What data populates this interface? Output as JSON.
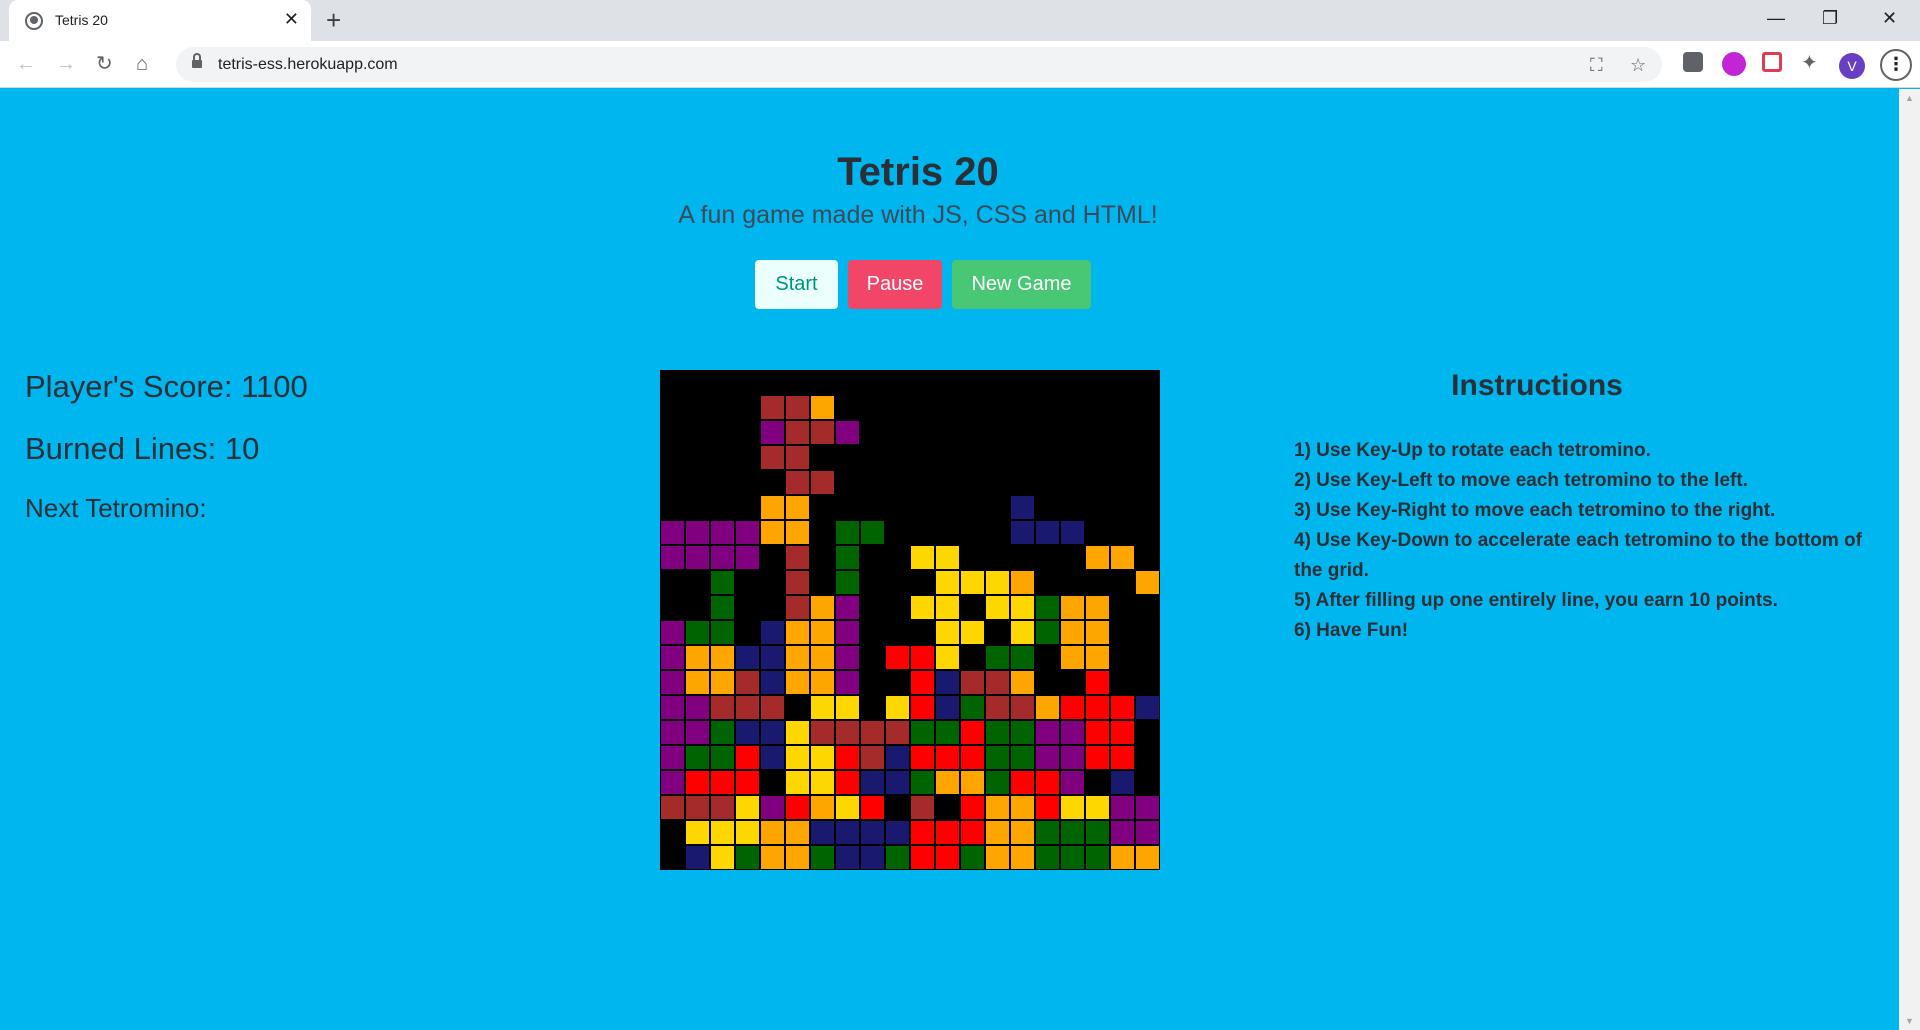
{
  "browser": {
    "tab_title": "Tetris 20",
    "tab_close": "✕",
    "new_tab": "+",
    "url": "tetris-ess.herokuapp.com",
    "minimize": "—",
    "restore": "❐",
    "close": "✕",
    "back": "←",
    "forward": "→",
    "reload": "↻",
    "home": "⌂",
    "translate": "⛶",
    "bookmark": "☆",
    "profile_initial": "V",
    "menu": "⋮",
    "extensions": "✦",
    "scroll_up": "▲",
    "scroll_down": "▼"
  },
  "header": {
    "title": "Tetris 20",
    "subtitle": "A fun game made with JS, CSS and HTML!"
  },
  "controls": {
    "start_label": "Start",
    "pause_label": "Pause",
    "new_game_label": "New Game"
  },
  "stats": {
    "score_text": "Player's Score: 1100",
    "burned_lines_text": "Burned Lines: 10",
    "next_tetromino_text": "Next Tetromino:"
  },
  "instructions": {
    "title": "Instructions",
    "items": [
      "1) Use Key-Up to rotate each tetromino.",
      "2) Use Key-Left to move each tetromino to the left.",
      "3) Use Key-Right to move each tetromino to the right.",
      "4) Use Key-Down to accelerate each tetromino to the bottom of the grid.",
      "5) After filling up one entirely line, you earn 10 points.",
      "6) Have Fun!"
    ]
  },
  "board": {
    "palette": {
      "K": "#000000",
      "R": "#a52a2a",
      "P": "#800080",
      "O": "#ffa500",
      "G": "#006400",
      "N": "#191970",
      "Y": "#ffd700",
      "X": "#ff0000"
    },
    "rows": [
      "KKKKKKKKKKKKKKKKKKKK",
      "KKKKRROKKKKKKKKKKKKK",
      "KKKKPRRPKKKKKKKKKKKK",
      "KKKKRRKKKKKKKKKKKKKK",
      "KKKKKRRKKKKKKKKKKKKK",
      "KKKKOOKKKKKKKKNKKKKK",
      "PPPPOOKGGKKKKKNNNKKK",
      "PPPPKRKGKKYYKKKKKOOK",
      "KKGKKRKGKKKYYYOKKKKO",
      "KKGKKROPKKYYKYYGOOKK",
      "PGGKNOOPKKKYYKYGOOKK",
      "POONNOOPKXXYKGGKOOKK",
      "POORNOOPKKXNRROKKXKK",
      "PPRRRKYYKYXNGRROXXXN",
      "PPGNNYRRRRGGXGGPPXXK",
      "PGGXNYYXRNXXXGGPPXXK",
      "PXXXKYYXNNGOOGXXPKNK",
      "RRRYPXOYXKRKXOOXYYPP",
      "KYYYOONNNNXXXOOGGGPP",
      "KNYGOOGNNGXXGOOGGGOO"
    ]
  }
}
